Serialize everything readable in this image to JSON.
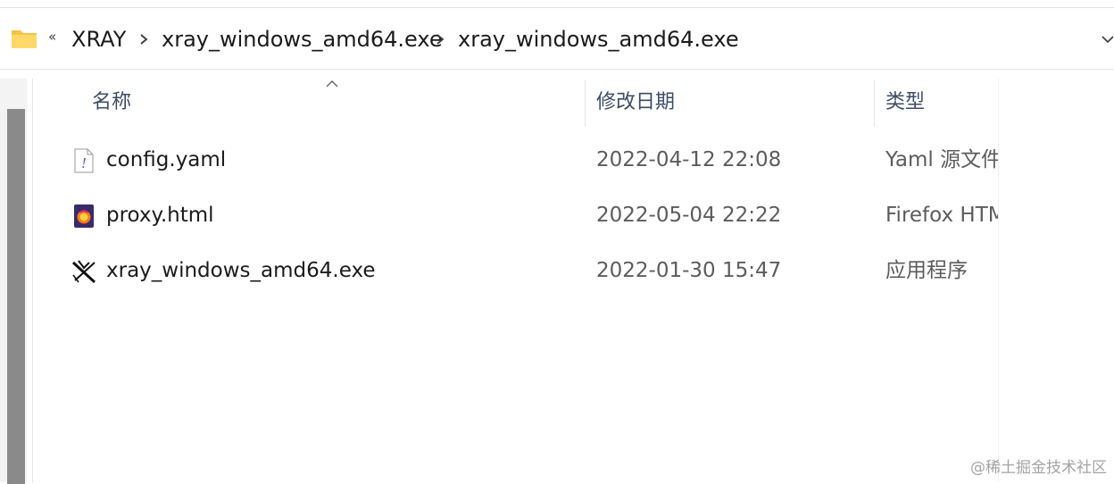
{
  "breadcrumb": {
    "overflow": "«",
    "items": [
      "XRAY",
      "xray_windows_amd64.exe",
      "xray_windows_amd64.exe"
    ],
    "folder_icon": "folder-icon",
    "dropdown_icon": "chevron-down-icon"
  },
  "columns": {
    "name": "名称",
    "date": "修改日期",
    "type": "类型",
    "sort": "ascending"
  },
  "files": [
    {
      "name": "config.yaml",
      "date": "2022-04-12 22:08",
      "type": "Yaml 源文件",
      "icon": "yaml-file-icon"
    },
    {
      "name": "proxy.html",
      "date": "2022-05-04 22:22",
      "type": "Firefox HTML",
      "icon": "firefox-html-icon"
    },
    {
      "name": "xray_windows_amd64.exe",
      "date": "2022-01-30 15:47",
      "type": "应用程序",
      "icon": "xray-exe-icon"
    }
  ],
  "watermark": "@稀土掘金技术社区",
  "colors": {
    "folder": "#f6c342",
    "header_text": "#3c4d66",
    "secondary_text": "#5c5c5c",
    "scroll_thumb": "#8a8a8a"
  }
}
